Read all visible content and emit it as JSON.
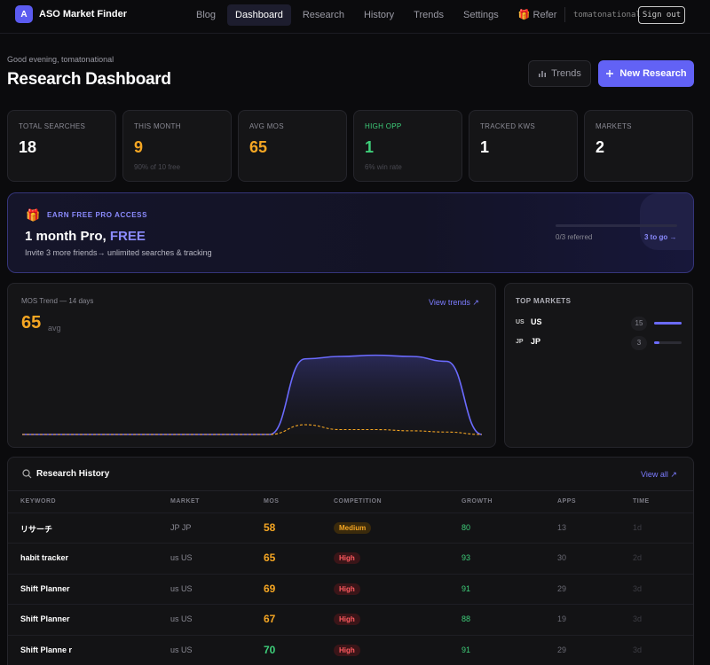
{
  "brand": {
    "logo_letter": "A",
    "name": "ASO Market Finder"
  },
  "nav": [
    {
      "label": "Blog",
      "active": false
    },
    {
      "label": "Dashboard",
      "active": true
    },
    {
      "label": "Research",
      "active": false
    },
    {
      "label": "History",
      "active": false
    },
    {
      "label": "Trends",
      "active": false
    },
    {
      "label": "Settings",
      "active": false
    },
    {
      "label": "🎁 Refer",
      "active": false
    }
  ],
  "user": {
    "name": "tomatonational",
    "signout_label": "Sign out"
  },
  "header": {
    "greeting": "Good evening, tomatonational",
    "title": "Research Dashboard",
    "trends_button": "Trends",
    "new_button": "New Research"
  },
  "stats": [
    {
      "label": "TOTAL SEARCHES",
      "value": "18",
      "sub": "",
      "color": "#ffffff"
    },
    {
      "label": "THIS MONTH",
      "value": "9",
      "sub": "90% of 10 free",
      "color": "#f5a623"
    },
    {
      "label": "AVG MOS",
      "value": "65",
      "sub": "",
      "color": "#f5a623"
    },
    {
      "label": "HIGH OPP",
      "value": "1",
      "sub": "6% win rate",
      "color": "#3ecf7a"
    },
    {
      "label": "TRACKED KWS",
      "value": "1",
      "sub": "",
      "color": "#ffffff"
    },
    {
      "label": "MARKETS",
      "value": "2",
      "sub": "",
      "color": "#ffffff"
    }
  ],
  "referral": {
    "eyebrow": "EARN FREE PRO ACCESS",
    "title_main": "1 month Pro, ",
    "title_accent": "FREE",
    "description": "Invite 3 more friends→ unlimited searches & tracking",
    "progress_text": "0/3 referred",
    "progress_fraction": 0,
    "togo": "3 to go →"
  },
  "trend": {
    "title": "MOS Trend — 14 days",
    "link": "View trends ↗",
    "value": "65",
    "value_suffix": "avg"
  },
  "chart_data": {
    "type": "area",
    "x": [
      1,
      2,
      3,
      4,
      5,
      6,
      7,
      8,
      9,
      10,
      11,
      12,
      13,
      14
    ],
    "series": [
      {
        "values": [
          0,
          0,
          0,
          0,
          0,
          0,
          0,
          0,
          62,
          64,
          65,
          64,
          60,
          0
        ],
        "color": "#6b6bff"
      },
      {
        "values": [
          0,
          0,
          0,
          0,
          0,
          0,
          0,
          0,
          8,
          4,
          4,
          3,
          2,
          0
        ],
        "color": "#f5a623"
      }
    ],
    "ylim": [
      0,
      80
    ],
    "grid": false
  },
  "markets": {
    "title": "TOP MARKETS",
    "items": [
      {
        "flag": "US",
        "name": "US",
        "count": "15",
        "fraction": 1.0
      },
      {
        "flag": "JP",
        "name": "JP",
        "count": "3",
        "fraction": 0.2
      }
    ]
  },
  "history": {
    "title": "Research History",
    "view_all": "View all ↗",
    "columns": [
      "KEYWORD",
      "MARKET",
      "MOS",
      "COMPETITION",
      "GROWTH",
      "APPS",
      "TIME"
    ],
    "rows": [
      {
        "keyword": "リサーチ",
        "market": "JP JP",
        "mos": "58",
        "mos_color": "#f5a623",
        "competition": "Medium",
        "growth": "80",
        "apps": "13",
        "time": "1d"
      },
      {
        "keyword": "habit tracker",
        "market": "us US",
        "mos": "65",
        "mos_color": "#f5a623",
        "competition": "High",
        "growth": "93",
        "apps": "30",
        "time": "2d"
      },
      {
        "keyword": "Shift Planner",
        "market": "us US",
        "mos": "69",
        "mos_color": "#f5a623",
        "competition": "High",
        "growth": "91",
        "apps": "29",
        "time": "3d"
      },
      {
        "keyword": "Shift Planner",
        "market": "us US",
        "mos": "67",
        "mos_color": "#f5a623",
        "competition": "High",
        "growth": "88",
        "apps": "19",
        "time": "3d"
      },
      {
        "keyword": "Shift Planne r",
        "market": "us US",
        "mos": "70",
        "mos_color": "#3ecf7a",
        "competition": "High",
        "growth": "91",
        "apps": "29",
        "time": "3d"
      }
    ]
  }
}
